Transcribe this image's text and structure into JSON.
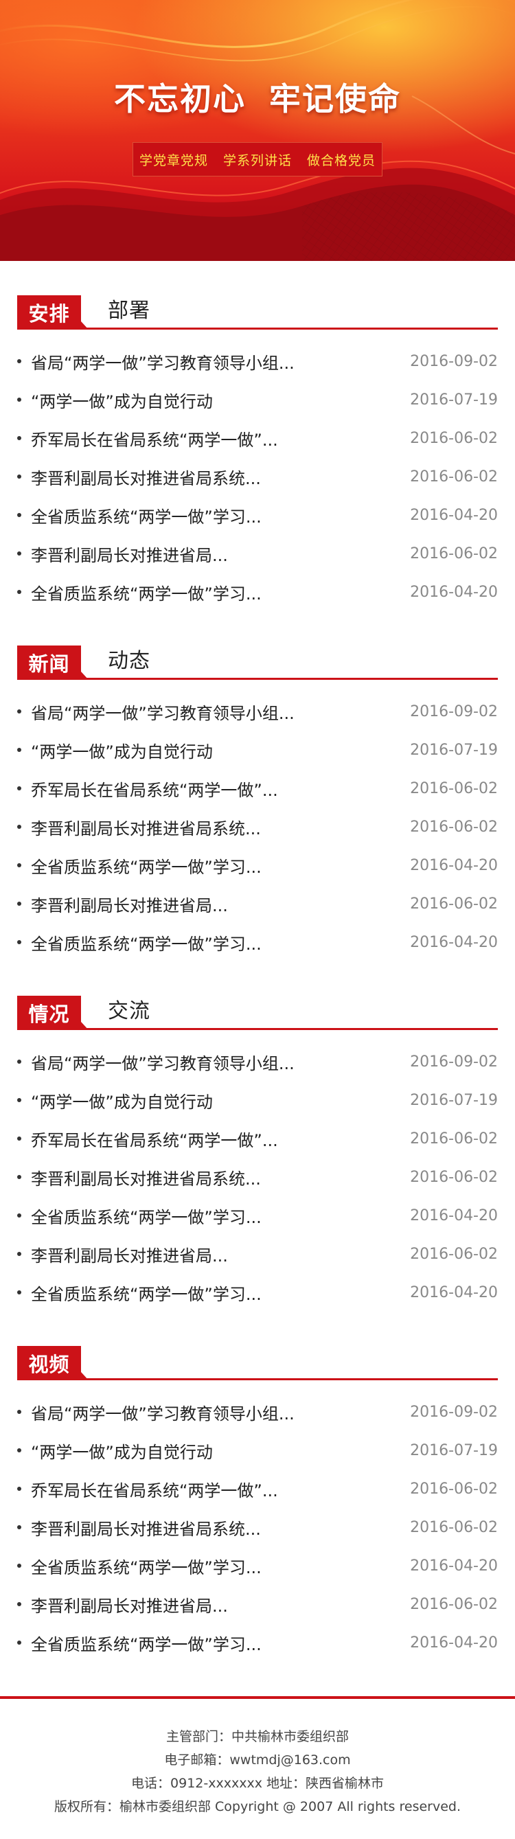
{
  "banner": {
    "title_part1": "不忘初心",
    "title_part2": "牢记使命",
    "subtitles": [
      "学党章党规",
      "学系列讲话",
      "做合格党员"
    ]
  },
  "colors": {
    "accent": "#cc1218",
    "slogan": "#ffe14a"
  },
  "sections": [
    {
      "tag": "安排",
      "title": "部署",
      "items": [
        {
          "title": "省局“两学一做”学习教育领导小组...",
          "date": "2016-09-02"
        },
        {
          "title": "“两学一做”成为自觉行动",
          "date": "2016-07-19"
        },
        {
          "title": "乔军局长在省局系统“两学一做”...",
          "date": "2016-06-02"
        },
        {
          "title": "李晋利副局长对推进省局系统...",
          "date": "2016-06-02"
        },
        {
          "title": "全省质监系统“两学一做”学习...",
          "date": "2016-04-20"
        },
        {
          "title": "李晋利副局长对推进省局...",
          "date": "2016-06-02"
        },
        {
          "title": "全省质监系统“两学一做”学习...",
          "date": "2016-04-20"
        }
      ]
    },
    {
      "tag": "新闻",
      "title": "动态",
      "items": [
        {
          "title": "省局“两学一做”学习教育领导小组...",
          "date": "2016-09-02"
        },
        {
          "title": "“两学一做”成为自觉行动",
          "date": "2016-07-19"
        },
        {
          "title": "乔军局长在省局系统“两学一做”...",
          "date": "2016-06-02"
        },
        {
          "title": "李晋利副局长对推进省局系统...",
          "date": "2016-06-02"
        },
        {
          "title": "全省质监系统“两学一做”学习...",
          "date": "2016-04-20"
        },
        {
          "title": "李晋利副局长对推进省局...",
          "date": "2016-06-02"
        },
        {
          "title": "全省质监系统“两学一做”学习...",
          "date": "2016-04-20"
        }
      ]
    },
    {
      "tag": "情况",
      "title": "交流",
      "items": [
        {
          "title": "省局“两学一做”学习教育领导小组...",
          "date": "2016-09-02"
        },
        {
          "title": "“两学一做”成为自觉行动",
          "date": "2016-07-19"
        },
        {
          "title": "乔军局长在省局系统“两学一做”...",
          "date": "2016-06-02"
        },
        {
          "title": "李晋利副局长对推进省局系统...",
          "date": "2016-06-02"
        },
        {
          "title": "全省质监系统“两学一做”学习...",
          "date": "2016-04-20"
        },
        {
          "title": "李晋利副局长对推进省局...",
          "date": "2016-06-02"
        },
        {
          "title": "全省质监系统“两学一做”学习...",
          "date": "2016-04-20"
        }
      ]
    },
    {
      "tag": "视频",
      "title": "",
      "items": [
        {
          "title": "省局“两学一做”学习教育领导小组...",
          "date": "2016-09-02"
        },
        {
          "title": "“两学一做”成为自觉行动",
          "date": "2016-07-19"
        },
        {
          "title": "乔军局长在省局系统“两学一做”...",
          "date": "2016-06-02"
        },
        {
          "title": "李晋利副局长对推进省局系统...",
          "date": "2016-06-02"
        },
        {
          "title": "全省质监系统“两学一做”学习...",
          "date": "2016-04-20"
        },
        {
          "title": "李晋利副局长对推进省局...",
          "date": "2016-06-02"
        },
        {
          "title": "全省质监系统“两学一做”学习...",
          "date": "2016-04-20"
        }
      ]
    }
  ],
  "footer": {
    "department": "主管部门：中共榆林市委组织部",
    "email": "电子邮箱：wwtmdj@163.com",
    "contact": "电话：0912-xxxxxxx 地址：陕西省榆林市",
    "copyright": "版权所有：榆林市委组织部 Copyright @ 2007 All rights reserved."
  }
}
